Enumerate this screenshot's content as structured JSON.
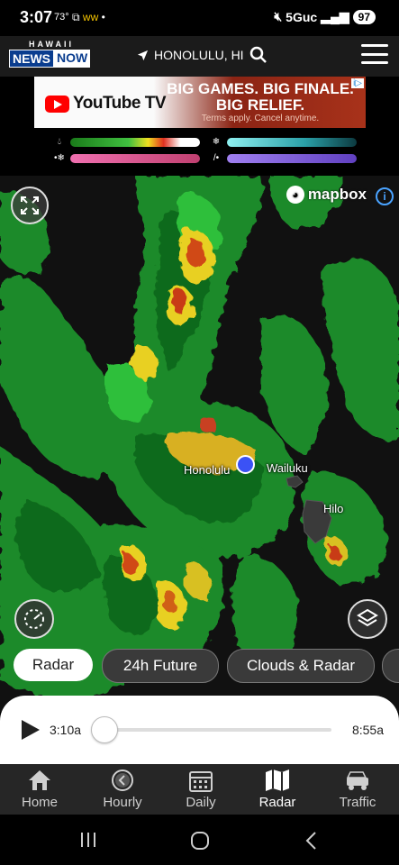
{
  "status_bar": {
    "time": "3:07",
    "temp": "73°",
    "network": "5Guc",
    "battery": "97"
  },
  "header": {
    "logo_top": "HAWAII",
    "logo_news": "NEWS",
    "logo_now": "NOW",
    "location": "HONOLULU, HI"
  },
  "ad": {
    "brand": "YouTube TV",
    "headline1": "BIG GAMES. BIG FINALE.",
    "headline2": "BIG RELIEF.",
    "subtext": "Terms apply. Cancel anytime.",
    "choice": "i▷"
  },
  "legend": {
    "rain_icon": "rain-icon",
    "snow_icon": "snow-icon",
    "mix_icon": "mix-icon",
    "ice_icon": "ice-icon",
    "colors": {
      "rain": [
        "#1a7a1a",
        "#40c040",
        "#f0e020",
        "#e03020",
        "#ffffff"
      ],
      "snow": [
        "#2aa0a8",
        "#8ff0f0"
      ],
      "mix": [
        "#c04070",
        "#f070b0"
      ],
      "ice": [
        "#6040c0",
        "#a080f0"
      ]
    }
  },
  "map": {
    "attribution": "mapbox",
    "cities": {
      "honolulu": "Honolulu",
      "wailuku": "Wailuku",
      "hilo": "Hilo"
    }
  },
  "layer_pills": [
    {
      "label": "Radar",
      "active": true
    },
    {
      "label": "24h Future",
      "active": false
    },
    {
      "label": "Clouds & Radar",
      "active": false
    }
  ],
  "player": {
    "start_time": "3:10a",
    "end_time": "8:55a",
    "progress": 0
  },
  "tabs": [
    {
      "label": "Home",
      "icon": "home-icon"
    },
    {
      "label": "Hourly",
      "icon": "clock-icon"
    },
    {
      "label": "Daily",
      "icon": "calendar-icon"
    },
    {
      "label": "Radar",
      "icon": "map-icon",
      "selected": true
    },
    {
      "label": "Traffic",
      "icon": "car-icon"
    }
  ]
}
